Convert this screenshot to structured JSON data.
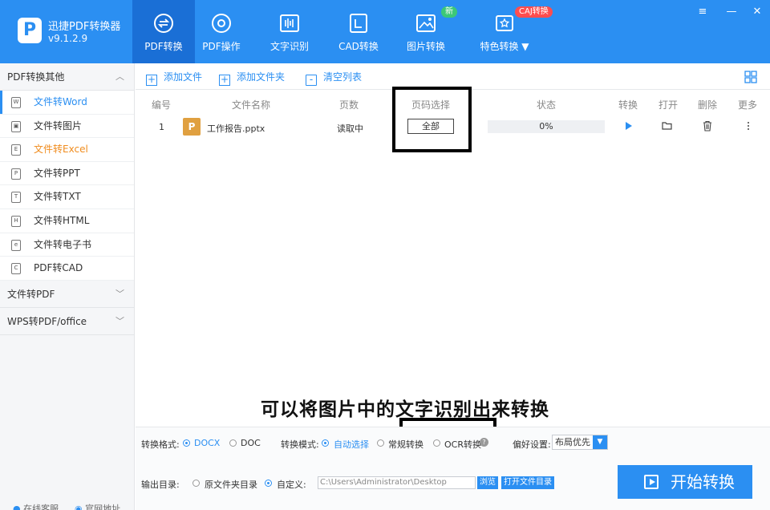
{
  "app": {
    "name": "迅捷PDF转换器",
    "version": "v9.1.2.9",
    "logo_letter": "P"
  },
  "nav": [
    {
      "label": "PDF转换",
      "icon": "swap-circle-icon"
    },
    {
      "label": "PDF操作",
      "icon": "gear-circle-icon"
    },
    {
      "label": "文字识别",
      "icon": "text-recognize-icon"
    },
    {
      "label": "CAD转换",
      "icon": "cad-icon"
    },
    {
      "label": "图片转换",
      "icon": "image-icon",
      "badge": "新"
    },
    {
      "label": "特色转换 ▼",
      "icon": "star-convert-icon",
      "badge": "CAJ转换"
    }
  ],
  "window_controls": {
    "menu": "≡",
    "minimize": "—",
    "close": "✕"
  },
  "sidebar": {
    "group1": "PDF转换其他",
    "items": [
      {
        "label": "文件转Word",
        "icon": "W"
      },
      {
        "label": "文件转图片",
        "icon": "▣"
      },
      {
        "label": "文件转Excel",
        "icon": "E"
      },
      {
        "label": "文件转PPT",
        "icon": "P"
      },
      {
        "label": "文件转TXT",
        "icon": "T"
      },
      {
        "label": "文件转HTML",
        "icon": "H"
      },
      {
        "label": "文件转电子书",
        "icon": "e"
      },
      {
        "label": "PDF转CAD",
        "icon": "C"
      }
    ],
    "group2": "文件转PDF",
    "group3": "WPS转PDF/office",
    "footer_service": "在线客服",
    "footer_site": "官网地址"
  },
  "toolbar": {
    "add_file": "添加文件",
    "add_folder": "添加文件夹",
    "clear_list": "清空列表"
  },
  "table": {
    "headers": {
      "num": "编号",
      "name": "文件名称",
      "pages": "页数",
      "page_select": "页码选择",
      "status": "状态",
      "convert": "转换",
      "open": "打开",
      "delete": "删除",
      "more": "更多"
    },
    "rows": [
      {
        "num": "1",
        "file_icon": "P",
        "name": "工作报告.pptx",
        "pages": "读取中",
        "page_select": "全部",
        "progress": 0,
        "progress_text": "0%"
      }
    ]
  },
  "caption": "可以将图片中的文字识别出来转换",
  "settings": {
    "format_label": "转换格式:",
    "format_docx": "DOCX",
    "format_doc": "DOC",
    "mode_label": "转换模式:",
    "mode_auto": "自动选择",
    "mode_normal": "常规转换",
    "mode_ocr": "OCR转换",
    "pref_label": "偏好设置:",
    "pref_value": "布局优先",
    "output_label": "输出目录:",
    "out_original": "原文件夹目录",
    "out_custom": "自定义:",
    "path": "C:\\Users\\Administrator\\Desktop",
    "browse": "浏览",
    "open_folder": "打开文件目录"
  },
  "start_button": "开始转换"
}
